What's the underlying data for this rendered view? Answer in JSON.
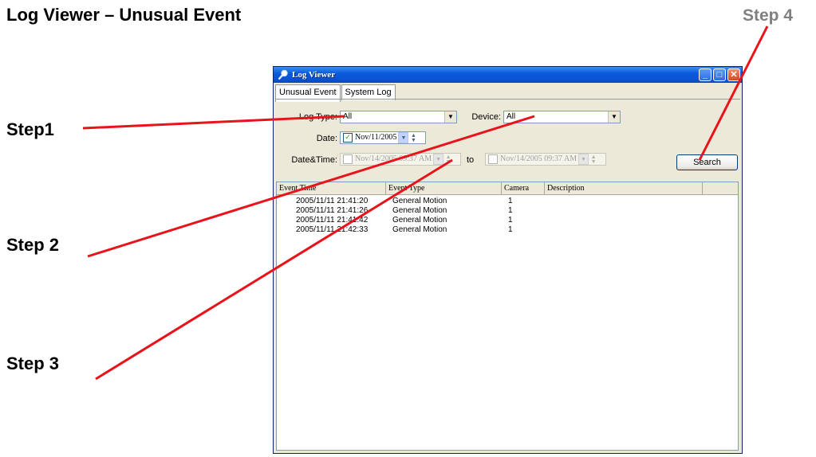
{
  "heading": "Log Viewer – Unusual Event",
  "steps": {
    "step1": "Step1",
    "step2": "Step 2",
    "step3": "Step 3",
    "step4": "Step 4"
  },
  "window": {
    "title": "Log Viewer",
    "icon": "magnifier-icon",
    "buttons": {
      "minimize": "_",
      "maximize": "□",
      "close": "✕"
    }
  },
  "tabs": [
    {
      "label": "Unusual Event",
      "active": true
    },
    {
      "label": "System Log",
      "active": false
    }
  ],
  "filters": {
    "log_type_label": "Log Type:",
    "log_type_value": "All",
    "device_label": "Device:",
    "device_value": "All",
    "date_label": "Date:",
    "date_checked": true,
    "date_value": "Nov/11/2005",
    "datetime_label": "Date&Time:",
    "datetime_from": "Nov/14/2005 09:37 AM",
    "datetime_to_label": "to",
    "datetime_to": "Nov/14/2005 09:37 AM"
  },
  "search_label": "Search",
  "table": {
    "columns": [
      "Event Time",
      "Event Type",
      "Camera",
      "Description"
    ],
    "rows": [
      {
        "time": "2005/11/11 21:41:20",
        "type": "General Motion",
        "camera": "1",
        "description": ""
      },
      {
        "time": "2005/11/11 21:41:26",
        "type": "General Motion",
        "camera": "1",
        "description": ""
      },
      {
        "time": "2005/11/11 21:41:42",
        "type": "General Motion",
        "camera": "1",
        "description": ""
      },
      {
        "time": "2005/11/11 21:42:33",
        "type": "General Motion",
        "camera": "1",
        "description": ""
      }
    ]
  },
  "colors": {
    "annotation_line": "#e8141c",
    "step4_text": "#808080",
    "titlebar": "#0a52d2"
  }
}
